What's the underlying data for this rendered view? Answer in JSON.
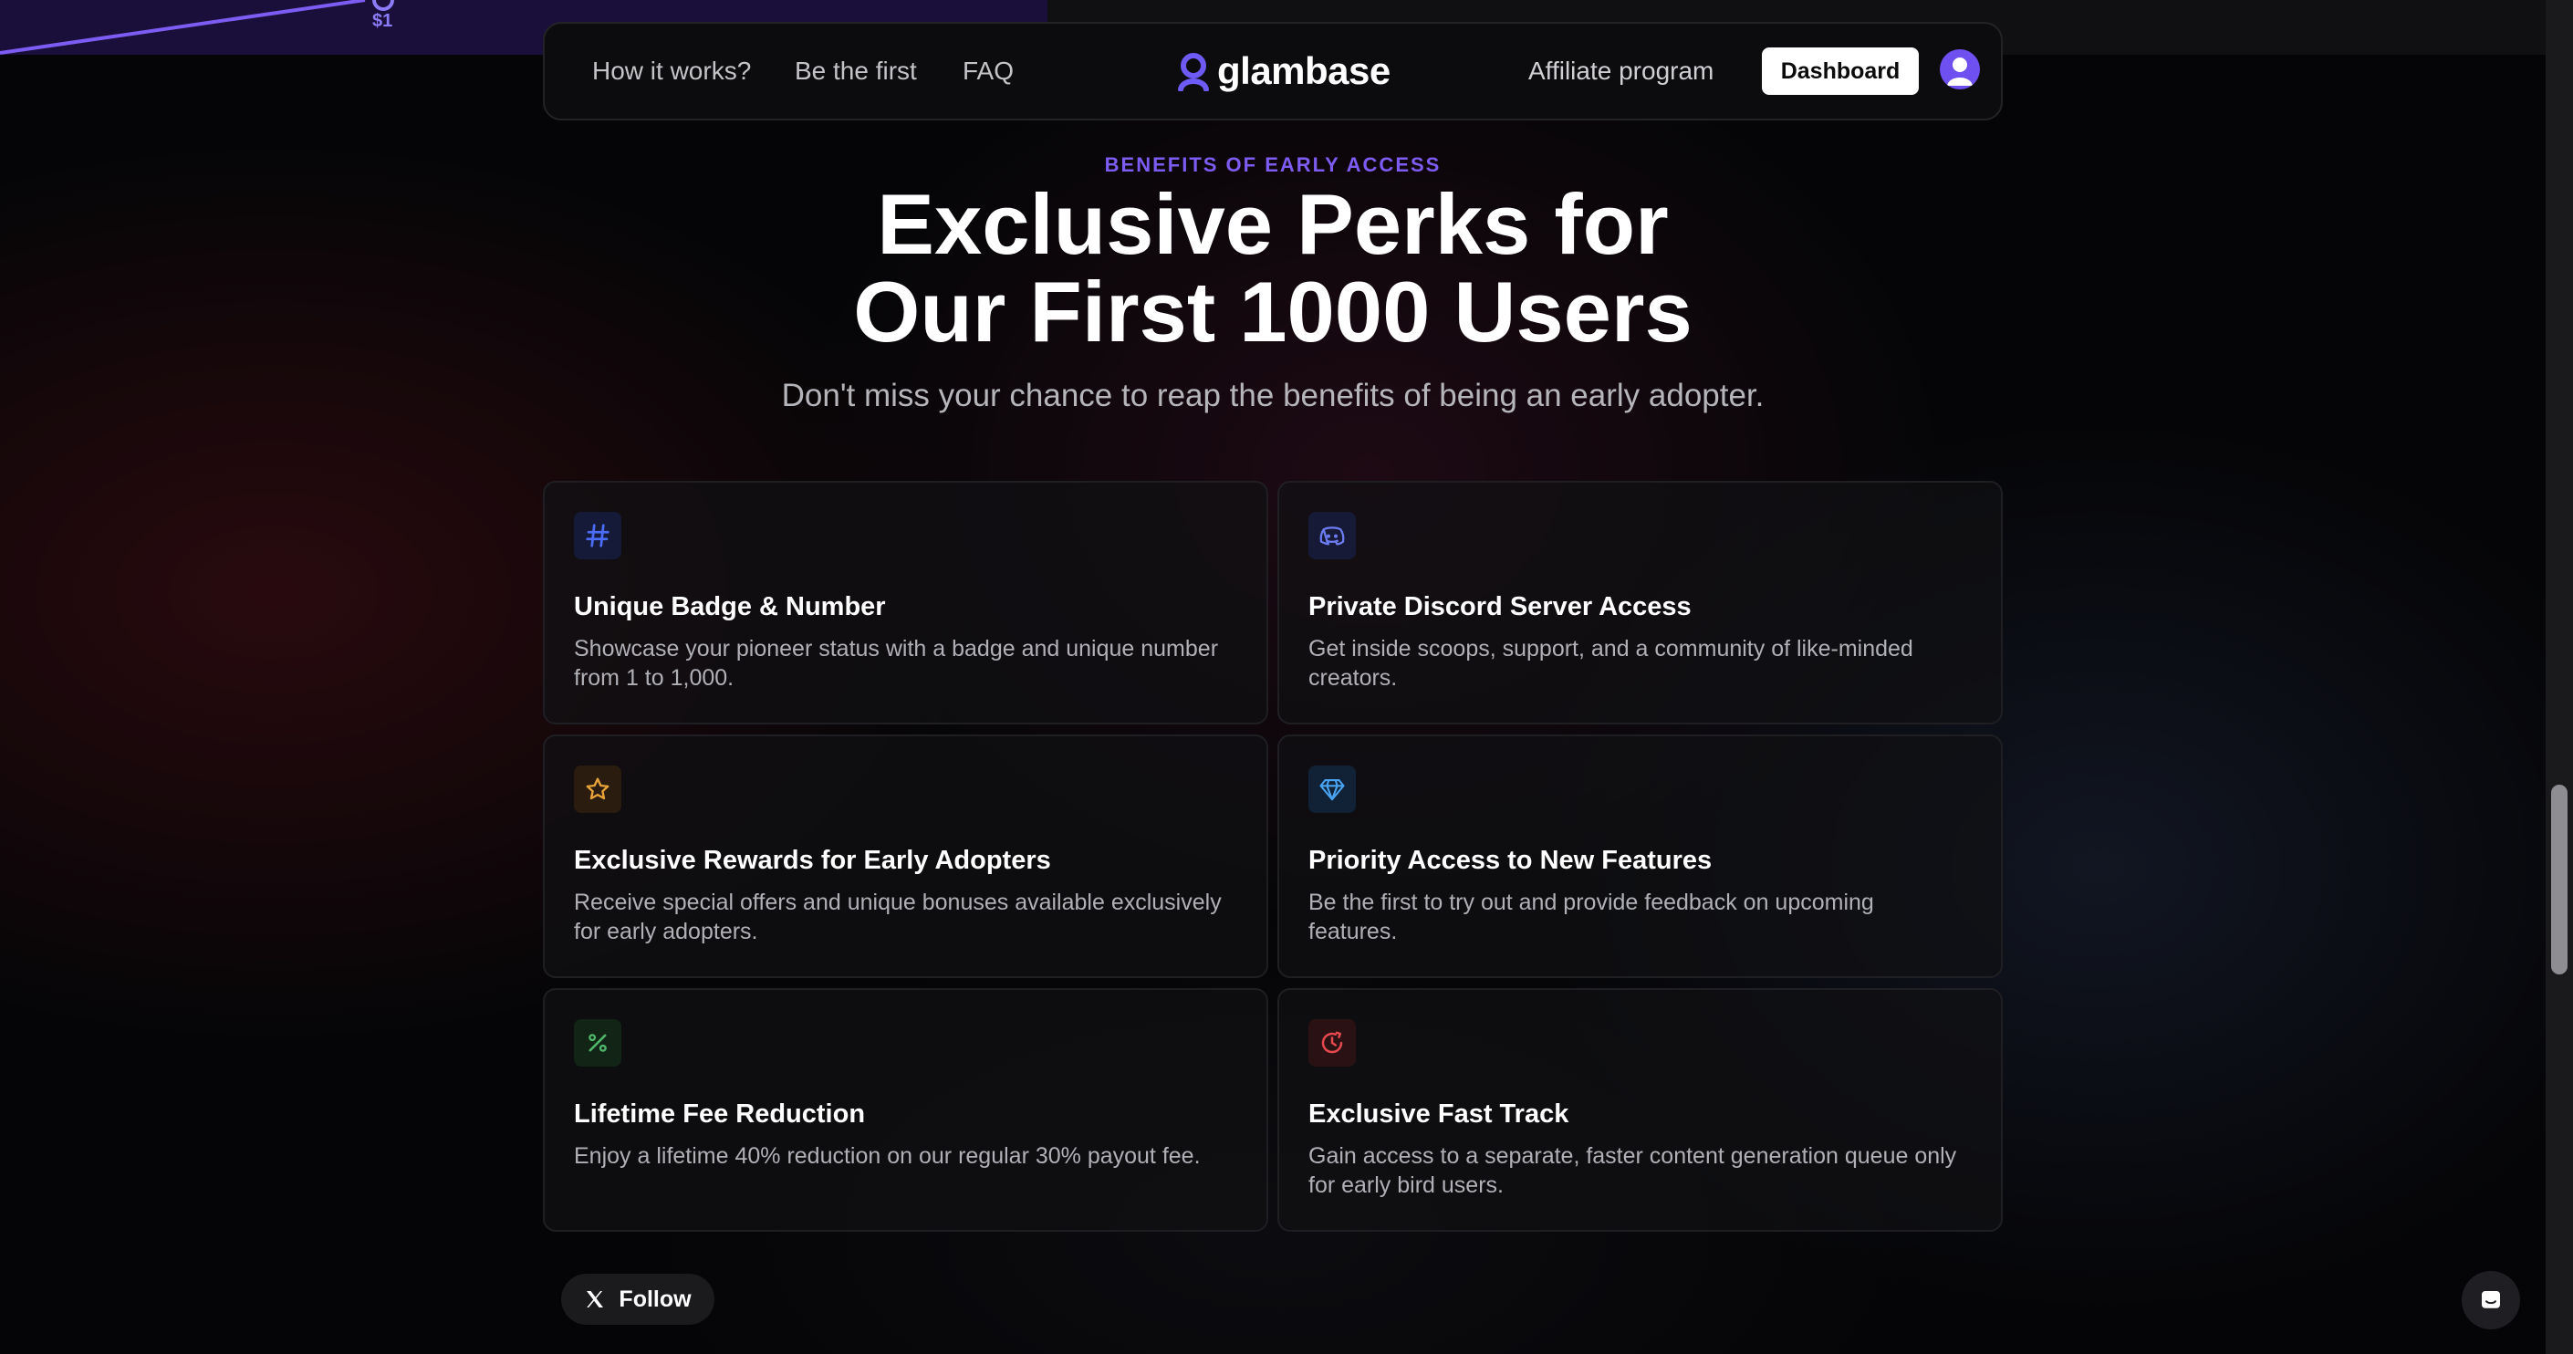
{
  "top_chart": {
    "label": "$1"
  },
  "nav": {
    "links_left": [
      "How it works?",
      "Be the first",
      "FAQ"
    ],
    "logo_text": "glambase",
    "affiliate": "Affiliate program",
    "dashboard": "Dashboard"
  },
  "hero": {
    "eyebrow": "BENEFITS OF EARLY ACCESS",
    "title_line1": "Exclusive Perks for",
    "title_line2": "Our First 1000 Users",
    "subtitle": "Don't miss your chance to reap the benefits of being an early adopter."
  },
  "cards": [
    {
      "icon": "hash-icon",
      "title": "Unique Badge & Number",
      "desc": "Showcase your pioneer status with a badge and unique number from 1 to 1,000."
    },
    {
      "icon": "discord-icon",
      "title": "Private Discord Server Access",
      "desc": "Get inside scoops, support, and a community of like-minded creators."
    },
    {
      "icon": "star-icon",
      "title": "Exclusive Rewards for Early Adopters",
      "desc": "Receive special offers and unique bonuses available exclusively for early adopters."
    },
    {
      "icon": "gem-icon",
      "title": "Priority Access to New Features",
      "desc": "Be the first to try out and provide feedback on upcoming features."
    },
    {
      "icon": "percent-icon",
      "title": "Lifetime Fee Reduction",
      "desc": "Enjoy a lifetime 40% reduction on our regular 30% payout fee."
    },
    {
      "icon": "clock-icon",
      "title": "Exclusive Fast Track",
      "desc": "Gain access to a separate, faster content generation queue only for early bird users."
    }
  ],
  "follow": {
    "label": "Follow"
  },
  "colors": {
    "accent": "#7c5cf2",
    "hash": "#4a6cf7",
    "star": "#e8a23a",
    "gem": "#49a3f0",
    "percent": "#4fb86a",
    "clock": "#e5484d"
  }
}
